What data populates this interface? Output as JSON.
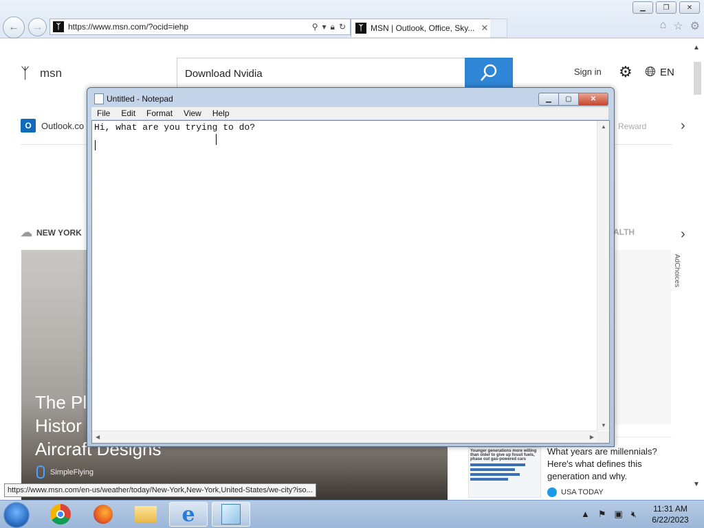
{
  "browser": {
    "address_url": "https://www.msn.com/?ocid=iehp",
    "tab_title": "MSN | Outlook, Office, Sky...",
    "status_url": "https://www.msn.com/en-us/weather/today/New-York,New-York,United-States/we-city?iso..."
  },
  "msn": {
    "brand": "msn",
    "search_query": "Download Nvidia",
    "signin": "Sign in",
    "language": "EN",
    "outlook_link": "Outlook.co",
    "rewards_link": "Reward",
    "weather_label": "NEW YORK",
    "health_label": "ALTH",
    "hero_title": "The Pl\nHistor\nAircraft Designs",
    "hero_source": "SimpleFlying",
    "adchoices": "AdChoices",
    "card_text": "What years are millennials? Here's what defines this generation and why.",
    "card_source": "USA TODAY",
    "card_thumb_caption": "Younger generations more willing than older to give up fossil fuels, phase out gas-powered cars"
  },
  "notepad": {
    "title": "Untitled - Notepad",
    "menu": [
      "File",
      "Edit",
      "Format",
      "View",
      "Help"
    ],
    "content": "Hi, what are you trying to do?"
  },
  "taskbar": {
    "time": "11:31 AM",
    "date": "6/22/2023"
  },
  "colors": {
    "search_button": "#2f86d6",
    "taskbar": "#9bb7d8",
    "close_button": "#c8452d"
  }
}
